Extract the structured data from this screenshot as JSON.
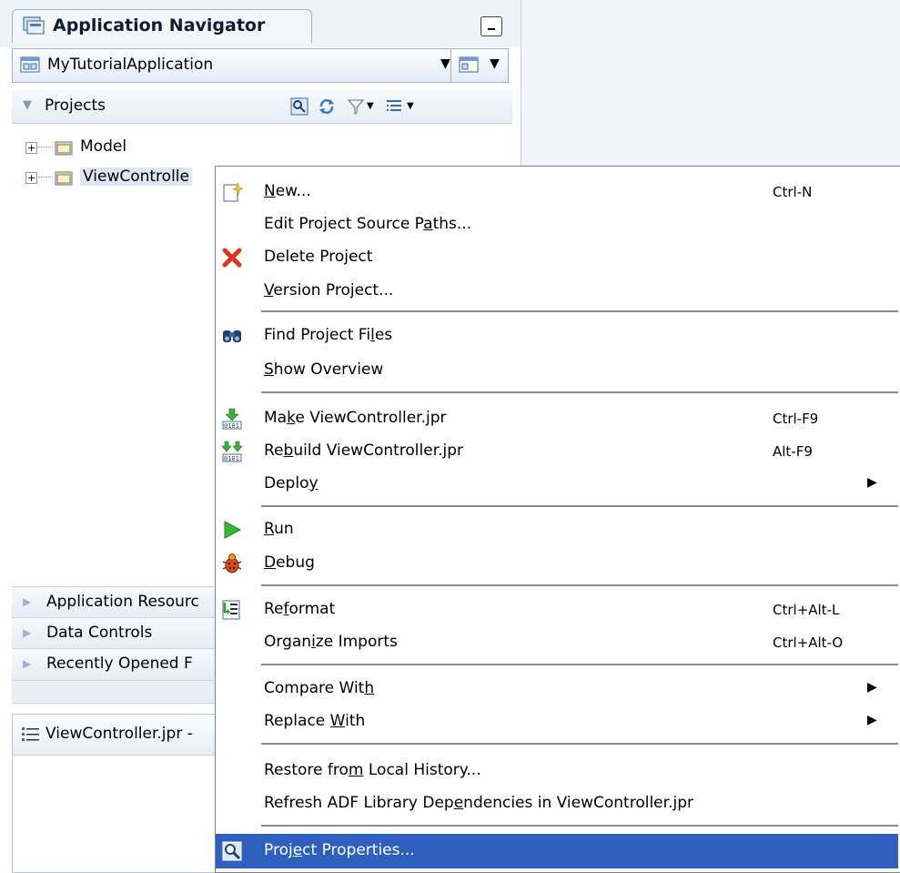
{
  "navigator": {
    "title": "Application Navigator",
    "app_selector": "MyTutorialApplication",
    "projects_label": "Projects",
    "tree": [
      {
        "label": "Model"
      },
      {
        "label": "ViewControlle"
      }
    ],
    "accordions": [
      {
        "label": "Application Resourc"
      },
      {
        "label": "Data Controls"
      },
      {
        "label": "Recently Opened F"
      }
    ],
    "structure_title": "ViewController.jpr -"
  },
  "menu": {
    "items": [
      {
        "pre": "",
        "u": "N",
        "post": "ew...",
        "accel": "Ctrl-N",
        "icon": "new-icon"
      },
      {
        "pre": "Edit Project Source P",
        "u": "a",
        "post": "ths...",
        "accel": "",
        "icon": ""
      },
      {
        "pre": "Delete Project",
        "u": "",
        "post": "",
        "accel": "",
        "icon": "delete-icon"
      },
      {
        "pre": "",
        "u": "V",
        "post": "ersion Project...",
        "accel": "",
        "icon": ""
      },
      {
        "pre": "Find Project Fi",
        "u": "l",
        "post": "es",
        "accel": "",
        "icon": "binoculars-icon"
      },
      {
        "pre": "",
        "u": "S",
        "post": "how Overview",
        "accel": "",
        "icon": ""
      },
      {
        "pre": "Ma",
        "u": "k",
        "post": "e ViewController.jpr",
        "accel": "Ctrl-F9",
        "icon": "make-icon"
      },
      {
        "pre": "Re",
        "u": "b",
        "post": "uild ViewController.jpr",
        "accel": "Alt-F9",
        "icon": "rebuild-icon"
      },
      {
        "pre": "Deplo",
        "u": "y",
        "post": "",
        "accel": "",
        "icon": ""
      },
      {
        "pre": "",
        "u": "R",
        "post": "un",
        "accel": "",
        "icon": "run-icon"
      },
      {
        "pre": "",
        "u": "D",
        "post": "ebug",
        "accel": "",
        "icon": "debug-icon"
      },
      {
        "pre": "Re",
        "u": "f",
        "post": "ormat",
        "accel": "Ctrl+Alt-L",
        "icon": "reformat-icon"
      },
      {
        "pre": "Organ",
        "u": "i",
        "post": "ze Imports",
        "accel": "Ctrl+Alt-O",
        "icon": ""
      },
      {
        "pre": "Compare Wit",
        "u": "h",
        "post": "",
        "accel": "",
        "icon": ""
      },
      {
        "pre": "Replace ",
        "u": "W",
        "post": "ith",
        "accel": "",
        "icon": ""
      },
      {
        "pre": "Restore fro",
        "u": "m",
        "post": " Local History...",
        "accel": "",
        "icon": ""
      },
      {
        "pre": "Refresh ADF Library Dep",
        "u": "e",
        "post": "ndencies in ViewController.jpr",
        "accel": "",
        "icon": ""
      },
      {
        "pre": "Proj",
        "u": "e",
        "post": "ct Properties...",
        "accel": "",
        "icon": "properties-icon"
      }
    ]
  },
  "colors": {
    "highlight": "#2f5fbf",
    "panel_header": "#e6edf6"
  }
}
